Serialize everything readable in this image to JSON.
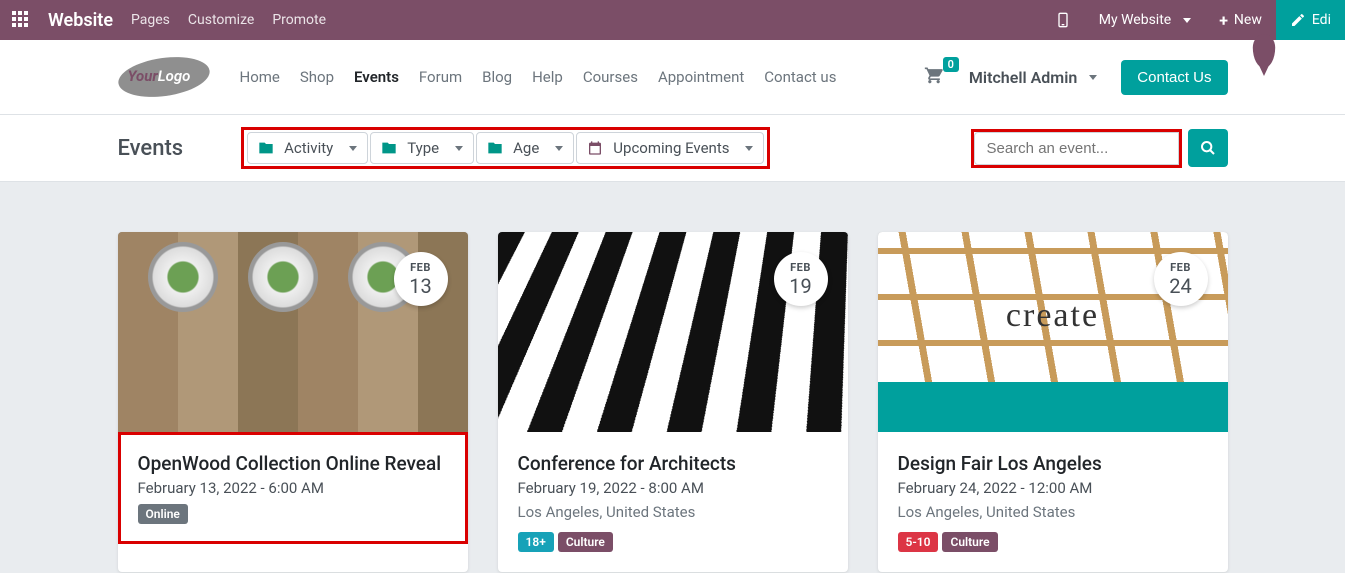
{
  "adminBar": {
    "brand": "Website",
    "links": {
      "pages": "Pages",
      "customize": "Customize",
      "promote": "Promote"
    },
    "myWebsite": "My Website",
    "new": "New",
    "edit": "Edi"
  },
  "nav": {
    "links": {
      "home": "Home",
      "shop": "Shop",
      "events": "Events",
      "forum": "Forum",
      "blog": "Blog",
      "help": "Help",
      "courses": "Courses",
      "appointment": "Appointment",
      "contact": "Contact us"
    },
    "cartCount": "0",
    "user": "Mitchell Admin",
    "contactBtn": "Contact Us",
    "logo": {
      "your": "Your",
      "logo": "Logo"
    }
  },
  "filters": {
    "pageTitle": "Events",
    "activity": "Activity",
    "type": "Type",
    "age": "Age",
    "upcoming": "Upcoming Events",
    "searchPlaceholder": "Search an event..."
  },
  "events": [
    {
      "month": "FEB",
      "day": "13",
      "title": "OpenWood Collection Online Reveal",
      "datetime": "February 13, 2022 - 6:00 AM",
      "location": "",
      "tags": [
        {
          "label": "Online",
          "cls": "gray"
        }
      ],
      "highlight": true,
      "img": "wood"
    },
    {
      "month": "FEB",
      "day": "19",
      "title": "Conference for Architects",
      "datetime": "February 19, 2022 - 8:00 AM",
      "location": "Los Angeles, United States",
      "tags": [
        {
          "label": "18+",
          "cls": "blue"
        },
        {
          "label": "Culture",
          "cls": "purple"
        }
      ],
      "highlight": false,
      "img": "building"
    },
    {
      "month": "FEB",
      "day": "24",
      "title": "Design Fair Los Angeles",
      "datetime": "February 24, 2022 - 12:00 AM",
      "location": "Los Angeles, United States",
      "tags": [
        {
          "label": "5-10",
          "cls": "red"
        },
        {
          "label": "Culture",
          "cls": "purple"
        }
      ],
      "highlight": false,
      "img": "create"
    }
  ]
}
